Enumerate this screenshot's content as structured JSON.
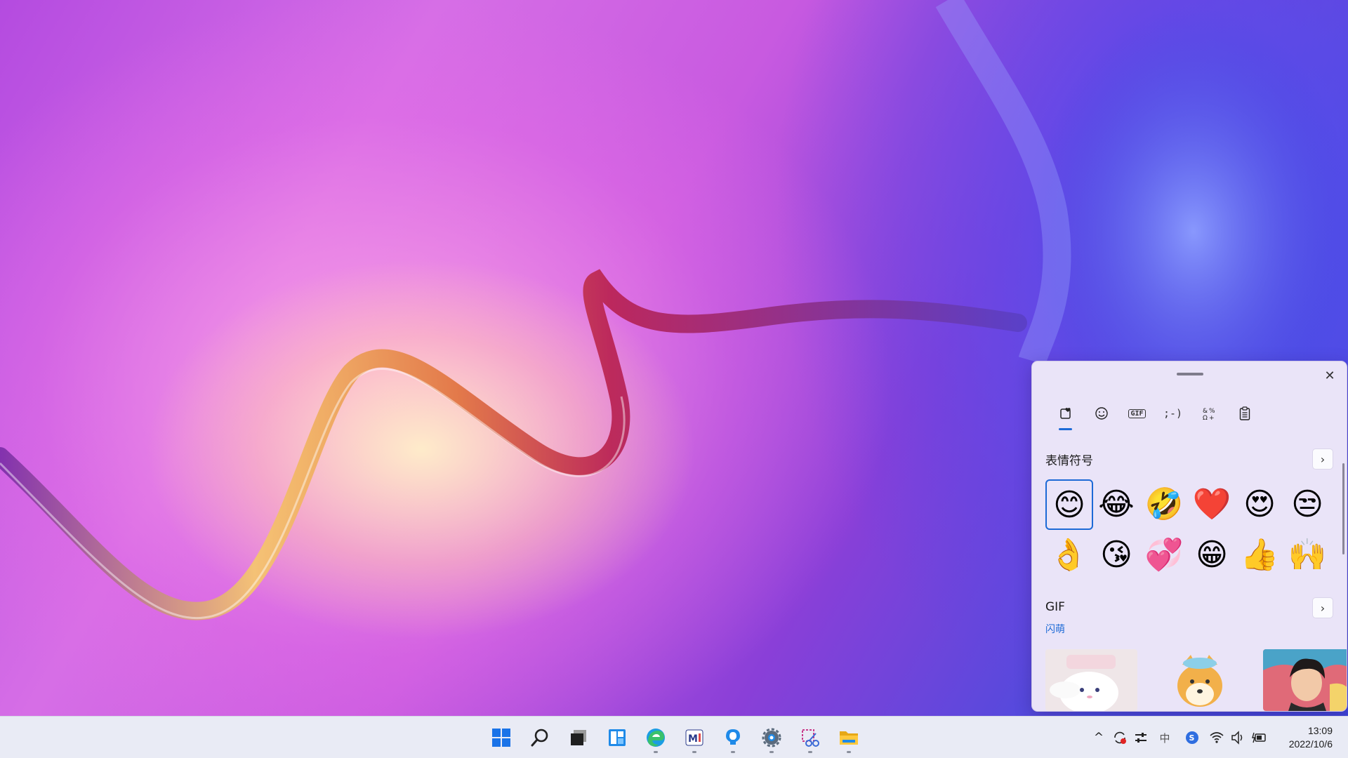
{
  "taskbar": {
    "apps": [
      {
        "name": "start-button",
        "running": false
      },
      {
        "name": "search-button",
        "running": false
      },
      {
        "name": "task-view-button",
        "running": false
      },
      {
        "name": "widgets-button",
        "running": false
      },
      {
        "name": "edge-button",
        "running": true
      },
      {
        "name": "mail-button",
        "running": true
      },
      {
        "name": "tips-button",
        "running": true
      },
      {
        "name": "settings-button",
        "running": true
      },
      {
        "name": "snipping-tool-button",
        "running": true
      },
      {
        "name": "file-explorer-button",
        "running": true
      }
    ],
    "tray": {
      "show_hidden_glyph": "^",
      "ime_glyph": "中",
      "time": "13:09",
      "date": "2022/10/6"
    }
  },
  "emoji_panel": {
    "close_glyph": "✕",
    "tabs": [
      {
        "name": "tab-recent",
        "glyph": "♡",
        "active": true
      },
      {
        "name": "tab-emoji",
        "glyph": "☺",
        "active": false
      },
      {
        "name": "tab-gif",
        "glyph": "GIF",
        "active": false
      },
      {
        "name": "tab-kaomoji",
        "glyph": ";-)",
        "active": false
      },
      {
        "name": "tab-symbols",
        "glyph": "Ω",
        "active": false
      },
      {
        "name": "tab-clipboard",
        "glyph": "📋",
        "active": false
      }
    ],
    "emoji_section": {
      "title": "表情符号",
      "items": [
        "😊",
        "😂",
        "🤣",
        "❤️",
        "😍",
        "😒",
        "👌",
        "😘",
        "💞",
        "😁",
        "👍",
        "🙌"
      ]
    },
    "gif_section": {
      "title": "GIF",
      "subtitle": "闪萌"
    },
    "chevron_glyph": "›",
    "accent_color": "#1d6ad6"
  }
}
